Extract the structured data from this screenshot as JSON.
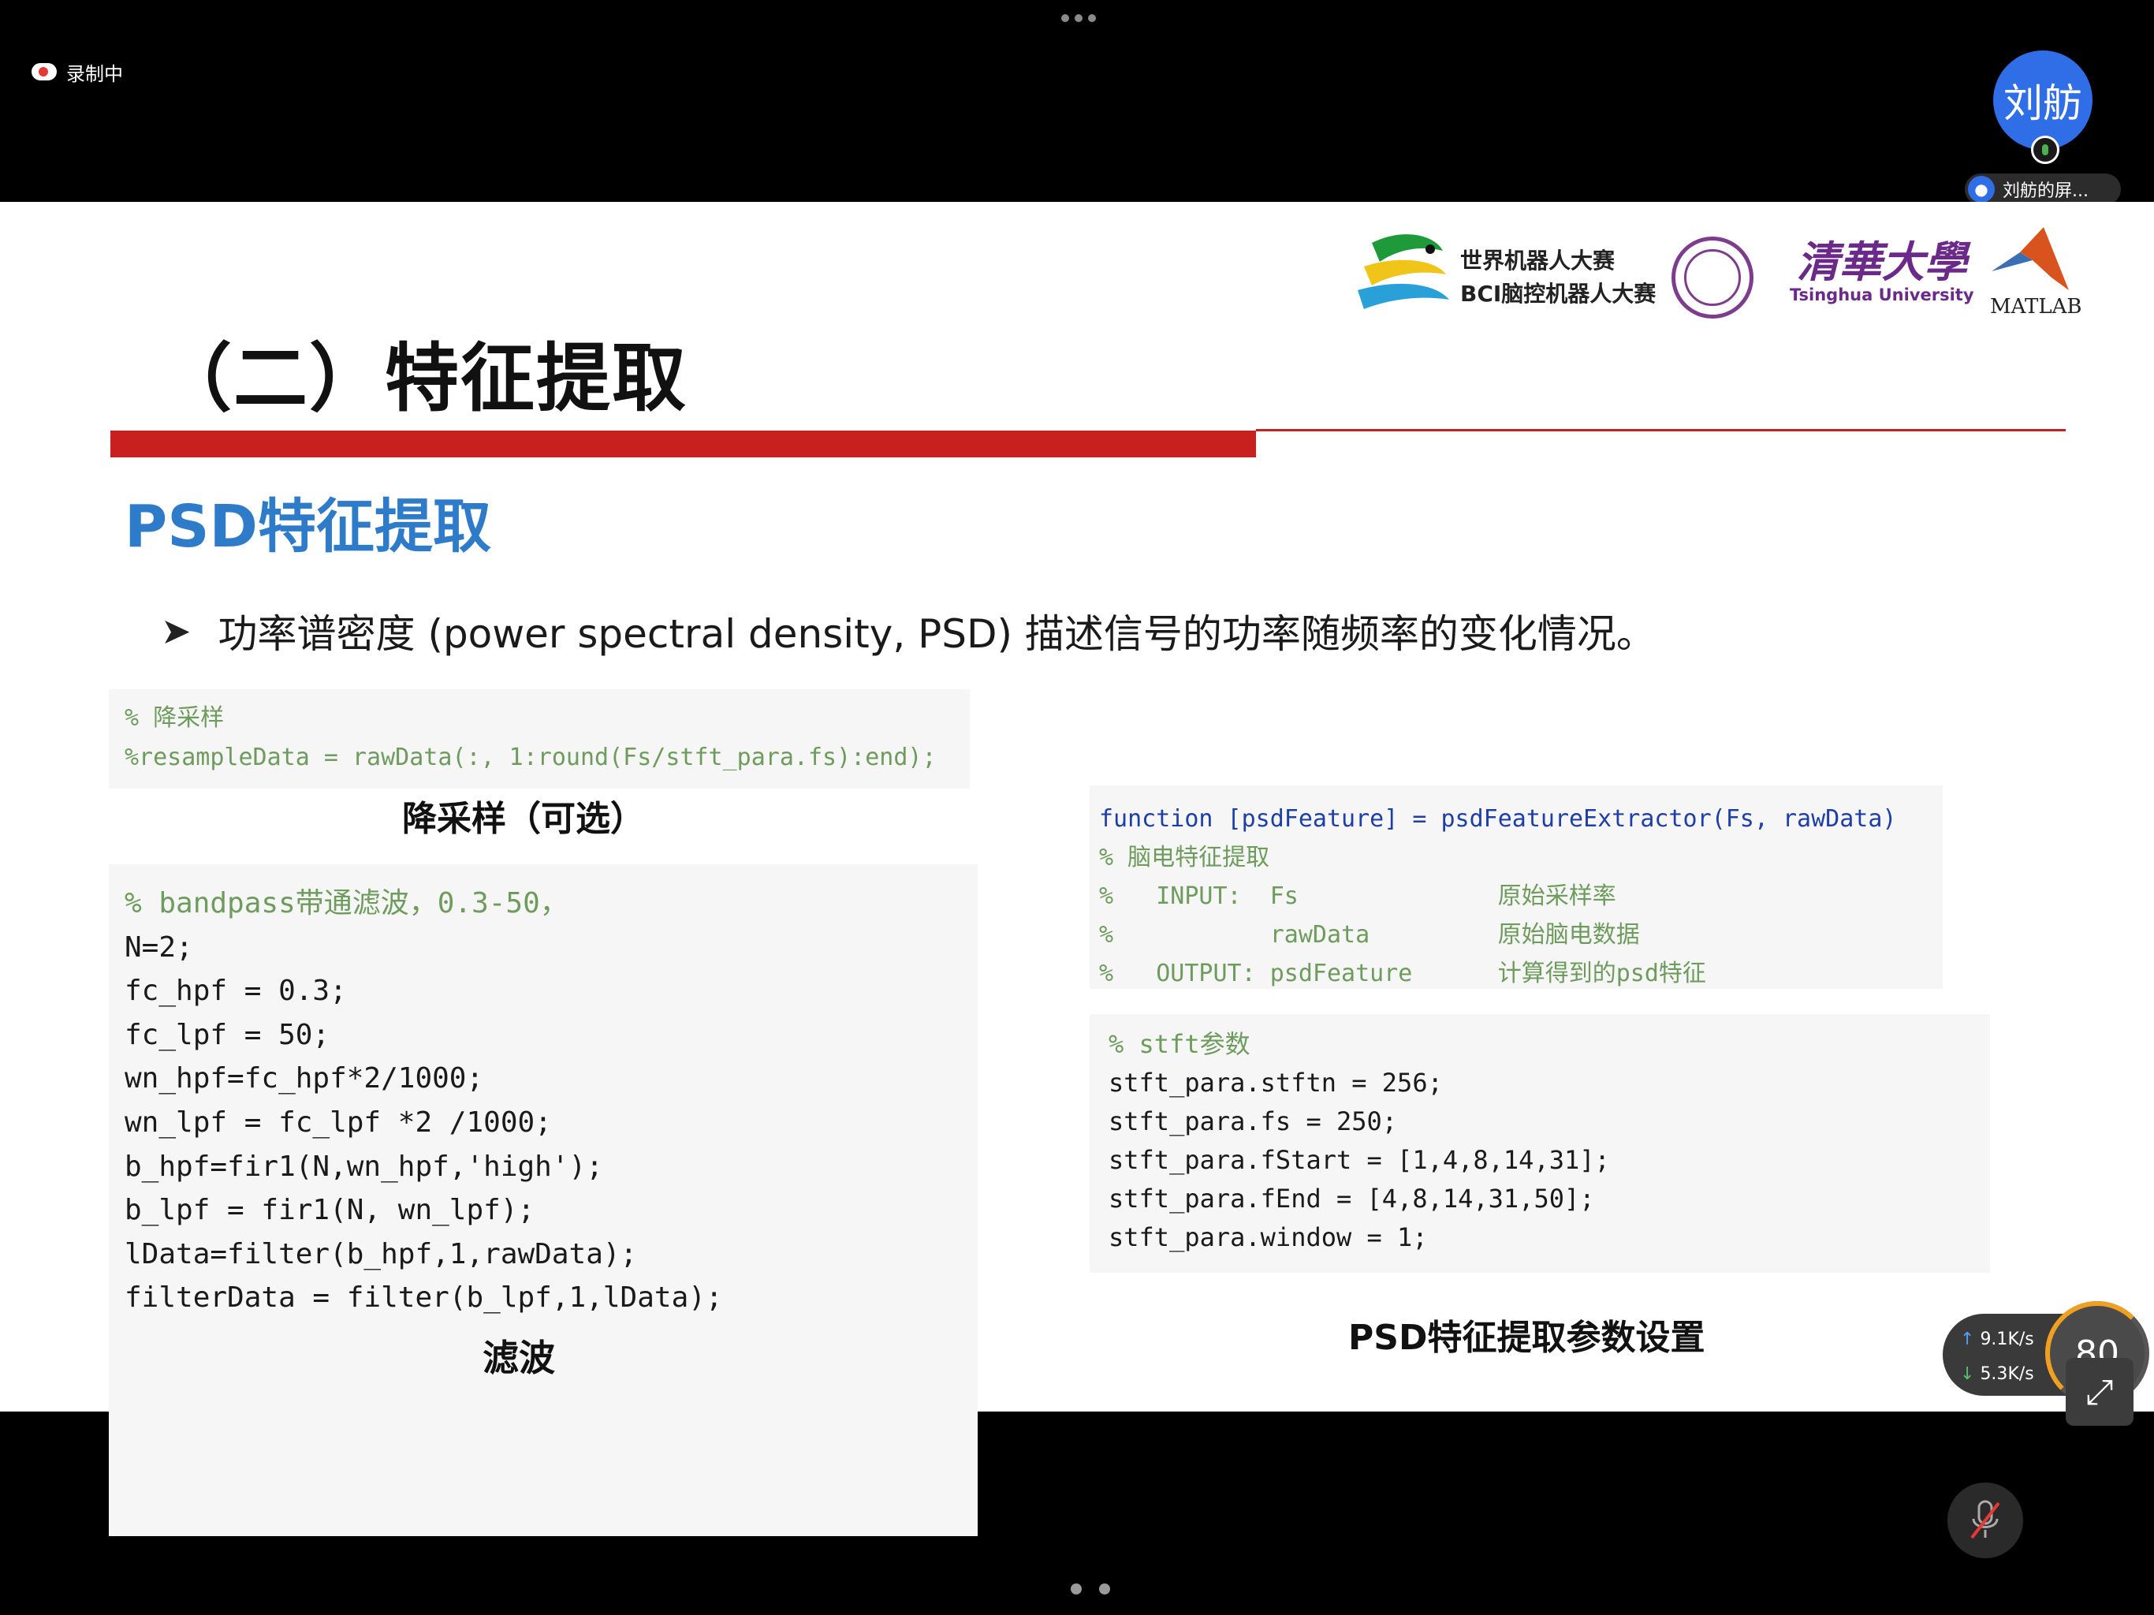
{
  "topbar": {
    "recording_label": "录制中",
    "avatar_initials": "刘舫",
    "share_label": "刘舫的屏..."
  },
  "slide": {
    "title": "（二）特征提取",
    "section_heading": "PSD特征提取",
    "bullet_text": "功率谱密度 (power spectral density, PSD) 描述信号的功率随频率的变化情况。",
    "logos": {
      "wrc_line1": "世界机器人大赛",
      "wrc_line2": "BCI脑控机器人大赛",
      "thu_cn": "清華大學",
      "thu_en": "Tsinghua University",
      "matlab": "MATLAB"
    },
    "resample": {
      "comment": "% 降采样",
      "code": "%resampleData = rawData(:, 1:round(Fs/stft_para.fs):end);",
      "caption": "降采样（可选）"
    },
    "filter": {
      "lines": [
        "% bandpass带通滤波，0.3-50，",
        "N=2;",
        "fc_hpf = 0.3;",
        "fc_lpf = 50;",
        "wn_hpf=fc_hpf*2/1000;",
        "wn_lpf = fc_lpf *2 /1000;",
        "b_hpf=fir1(N,wn_hpf,'high');",
        "b_lpf = fir1(N, wn_lpf);",
        "lData=filter(b_hpf,1,rawData);",
        "filterData = filter(b_lpf,1,lData);"
      ],
      "caption": "滤波"
    },
    "func": {
      "lines": [
        "function [psdFeature] = psdFeatureExtractor(Fs, rawData)",
        "% 脑电特征提取",
        "%   INPUT:  Fs              原始采样率",
        "%           rawData         原始脑电数据",
        "%   OUTPUT: psdFeature      计算得到的psd特征"
      ]
    },
    "stft": {
      "lines": [
        "% stft参数",
        "stft_para.stftn = 256;",
        "stft_para.fs = 250;",
        "stft_para.fStart = [1,4,8,14,31];",
        "stft_para.fEnd = [4,8,14,31,50];",
        "stft_para.window = 1;"
      ],
      "caption": "PSD特征提取参数设置"
    }
  },
  "speed_widget": {
    "upload": "9.1",
    "download": "5.3",
    "unit": "K/s",
    "gauge": "80"
  },
  "colors": {
    "accent_red": "#c8201f",
    "heading_blue": "#2e7bc9",
    "avatar_blue": "#2f6ee6"
  }
}
